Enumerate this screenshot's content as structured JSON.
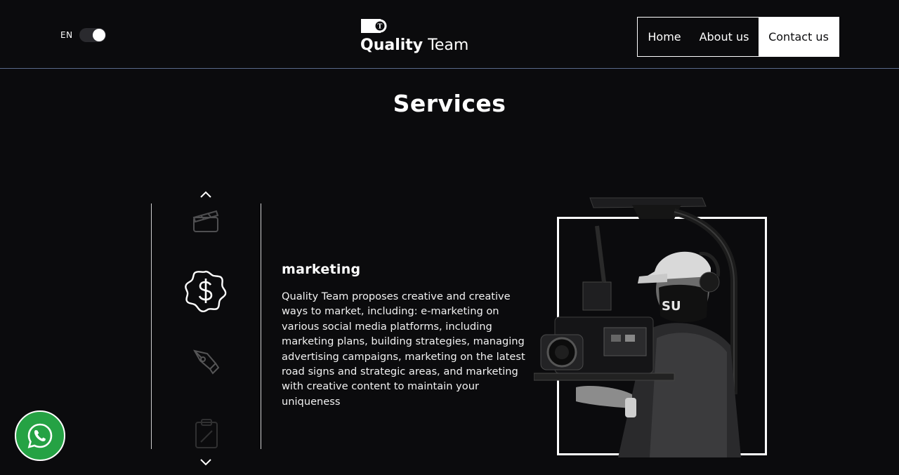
{
  "header": {
    "language": "EN",
    "brand_bold": "Quality",
    "brand_light": "Team",
    "nav": {
      "home": "Home",
      "about": "About us",
      "contact": "Contact us"
    }
  },
  "services": {
    "title": "Services",
    "active": {
      "name": "marketing",
      "description": "Quality Team proposes creative and creative ways to market, including: e-marketing on various social media platforms, including marketing plans, building strategies, managing advertising campaigns, marketing on the latest road signs and strategic areas, and marketing with creative content to maintain your uniqueness"
    },
    "icons": [
      "clapperboard-icon",
      "dollar-badge-icon",
      "pen-nib-icon",
      "clipboard-icon"
    ]
  },
  "colors": {
    "background": "#0b0b0d",
    "accent": "#ffffff",
    "whatsapp": "#25a244"
  }
}
